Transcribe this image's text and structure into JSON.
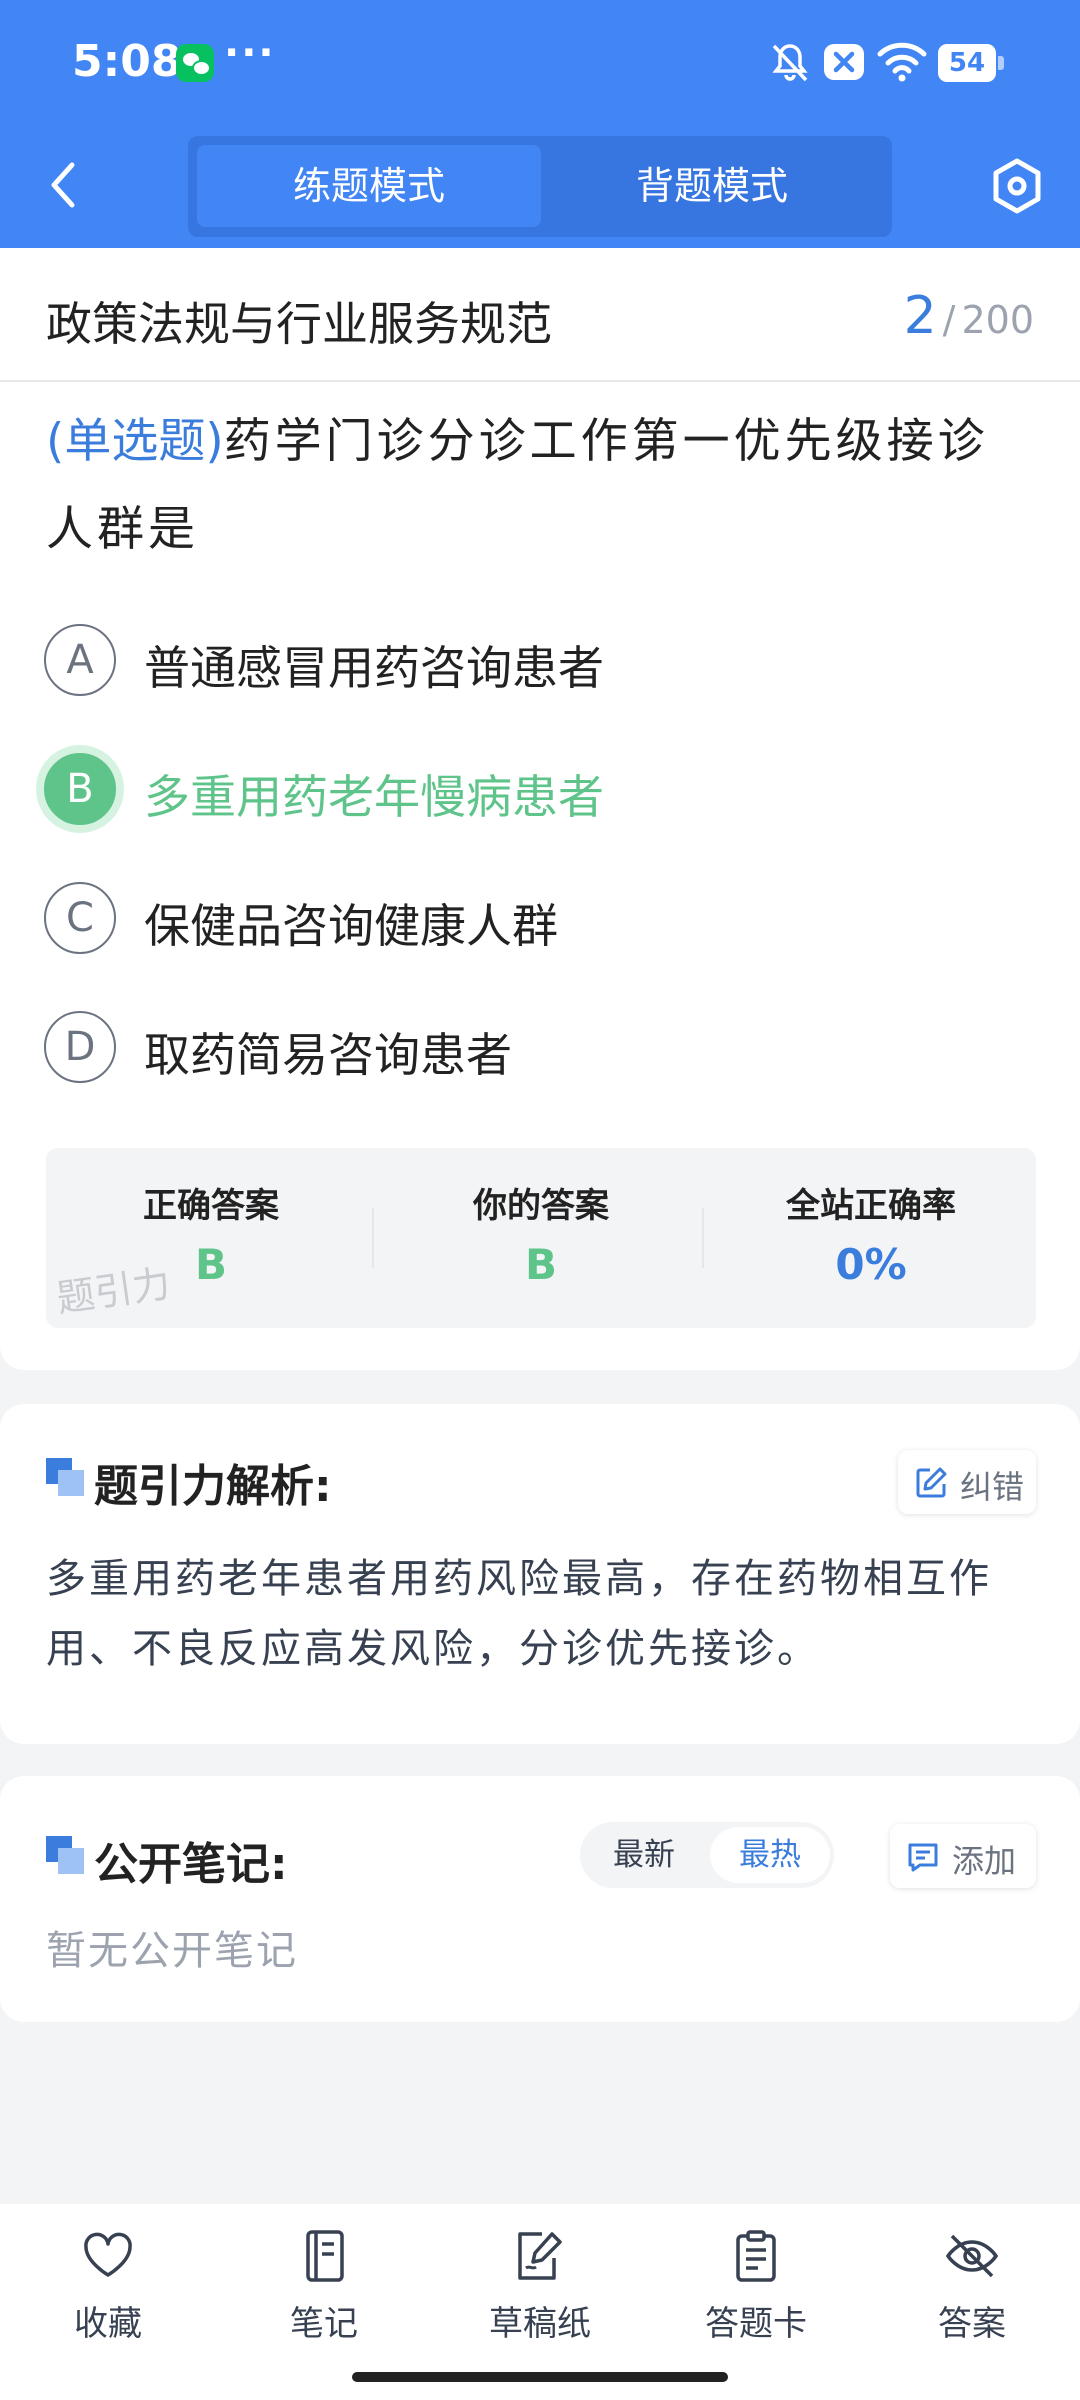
{
  "status_bar": {
    "time": "5:08",
    "more": "···",
    "battery": "54",
    "icons": [
      "wechat-icon",
      "bell-off-icon",
      "close-badge-icon",
      "wifi-icon",
      "battery-icon"
    ]
  },
  "nav": {
    "modes": [
      "练题模式",
      "背题模式"
    ],
    "active_mode": "练题模式",
    "icons": [
      "back-arrow-icon",
      "settings-icon"
    ]
  },
  "question": {
    "subject": "政策法规与行业服务规范",
    "current": "2",
    "separator": "/",
    "total": "200",
    "type": "(单选题)",
    "text": "药学门诊分诊工作第一优先级接诊人群是",
    "options": [
      {
        "letter": "A",
        "text": "普通感冒用药咨询患者"
      },
      {
        "letter": "B",
        "text": "多重用药老年慢病患者"
      },
      {
        "letter": "C",
        "text": "保健品咨询健康人群"
      },
      {
        "letter": "D",
        "text": "取药简易咨询患者"
      }
    ],
    "selected": "B"
  },
  "result": {
    "correct_label": "正确答案",
    "correct_value": "B",
    "yours_label": "你的答案",
    "yours_value": "B",
    "rate_label": "全站正确率",
    "rate_value": "0%",
    "watermark": "题引力"
  },
  "analysis": {
    "title": "题引力解析:",
    "report_label": "纠错",
    "text": "多重用药老年患者用药风险最高，存在药物相互作用、不良反应高发风险，分诊优先接诊。"
  },
  "notes": {
    "title": "公开笔记:",
    "sort_options": [
      "最新",
      "最热"
    ],
    "active_sort": "最热",
    "add_label": "添加",
    "empty_text": "暂无公开笔记"
  },
  "bottom_bar": {
    "items": [
      {
        "label": "收藏",
        "icon": "heart-icon"
      },
      {
        "label": "笔记",
        "icon": "notebook-icon"
      },
      {
        "label": "草稿纸",
        "icon": "draft-icon"
      },
      {
        "label": "答题卡",
        "icon": "answer-card-icon"
      },
      {
        "label": "答案",
        "icon": "eye-off-icon"
      }
    ]
  },
  "colors": {
    "primary": "#4285f4",
    "accent_blue": "#3b7ddd",
    "correct_green": "#5ec48a",
    "background": "#f3f4f6"
  }
}
